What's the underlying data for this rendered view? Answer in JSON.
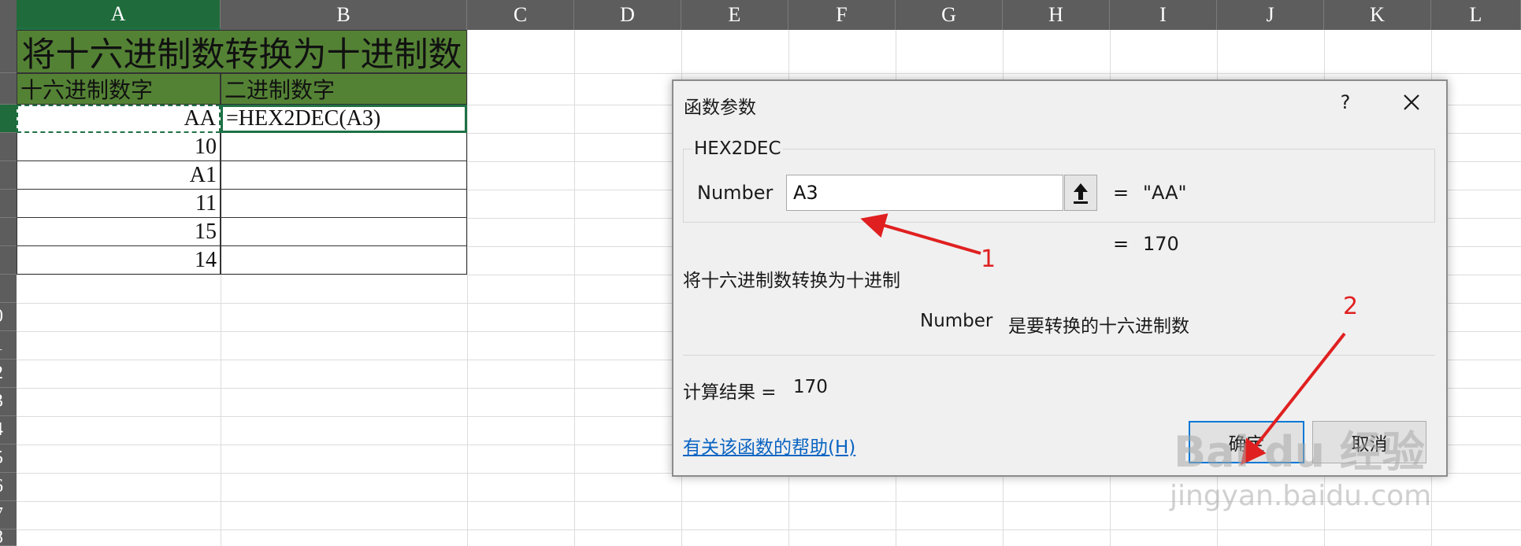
{
  "sheet": {
    "columns": [
      "A",
      "B",
      "C",
      "D",
      "E",
      "F",
      "G",
      "H",
      "I",
      "J",
      "K",
      "L"
    ],
    "rows": [
      "",
      "",
      "",
      "",
      "",
      "",
      "",
      "",
      "",
      "0",
      "1",
      "2",
      "3",
      "4",
      "5",
      "6",
      "7",
      "8"
    ],
    "title": "将十六进制数转换为十进制数",
    "headers": {
      "a": "十六进制数字",
      "b": "二进制数字"
    },
    "data": [
      {
        "a": "AA",
        "b": "=HEX2DEC(A3)"
      },
      {
        "a": "10",
        "b": ""
      },
      {
        "a": "A1",
        "b": ""
      },
      {
        "a": "11",
        "b": ""
      },
      {
        "a": "15",
        "b": ""
      },
      {
        "a": "14",
        "b": ""
      }
    ]
  },
  "dialog": {
    "title": "函数参数",
    "help_button": "?",
    "function_name": "HEX2DEC",
    "argument_label": "Number",
    "argument_value": "A3",
    "argument_eq": "=",
    "argument_result": "\"AA\"",
    "function_eq": "=",
    "function_result": "170",
    "function_description": "将十六进制数转换为十进制",
    "argument_desc_name": "Number",
    "argument_desc_text": "是要转换的十六进制数",
    "result_label": "计算结果 =",
    "result_value": "170",
    "help_link": "有关该函数的帮助(H)",
    "ok_label": "确定",
    "cancel_label": "取消"
  },
  "annotations": {
    "marker1": "1",
    "marker2": "2",
    "arrow_color": "#e02020"
  },
  "watermark": {
    "brand": "Bai du 经验",
    "url": "jingyan.baidu.com"
  },
  "colors": {
    "header_green": "#548235",
    "selection_green": "#1e7145",
    "link_blue": "#0a64c2"
  }
}
